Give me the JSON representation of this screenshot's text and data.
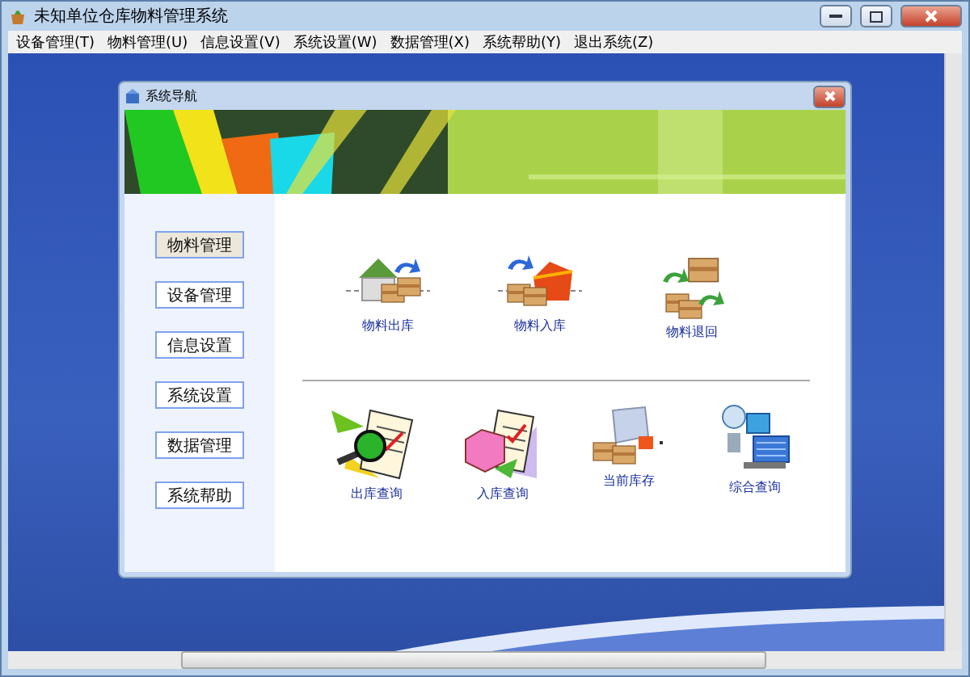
{
  "window": {
    "title": "未知单位仓库物料管理系统"
  },
  "menu": [
    "设备管理(T)",
    "物料管理(U)",
    "信息设置(V)",
    "系统设置(W)",
    "数据管理(X)",
    "系统帮助(Y)",
    "退出系统(Z)"
  ],
  "dialog": {
    "title": "系统导航"
  },
  "nav_buttons": [
    {
      "label": "物料管理",
      "selected": true
    },
    {
      "label": "设备管理",
      "selected": false
    },
    {
      "label": "信息设置",
      "selected": false
    },
    {
      "label": "系统设置",
      "selected": false
    },
    {
      "label": "数据管理",
      "selected": false
    },
    {
      "label": "系统帮助",
      "selected": false
    }
  ],
  "actions_top": [
    {
      "label": "物料出库",
      "kind": "outbound"
    },
    {
      "label": "物料入库",
      "kind": "inbound"
    },
    {
      "label": "物料退回",
      "kind": "return"
    }
  ],
  "actions_bottom": [
    {
      "label": "出库查询",
      "kind": "outquery"
    },
    {
      "label": "入库查询",
      "kind": "inquery"
    },
    {
      "label": "当前库存",
      "kind": "stock"
    },
    {
      "label": "综合查询",
      "kind": "combined"
    }
  ]
}
